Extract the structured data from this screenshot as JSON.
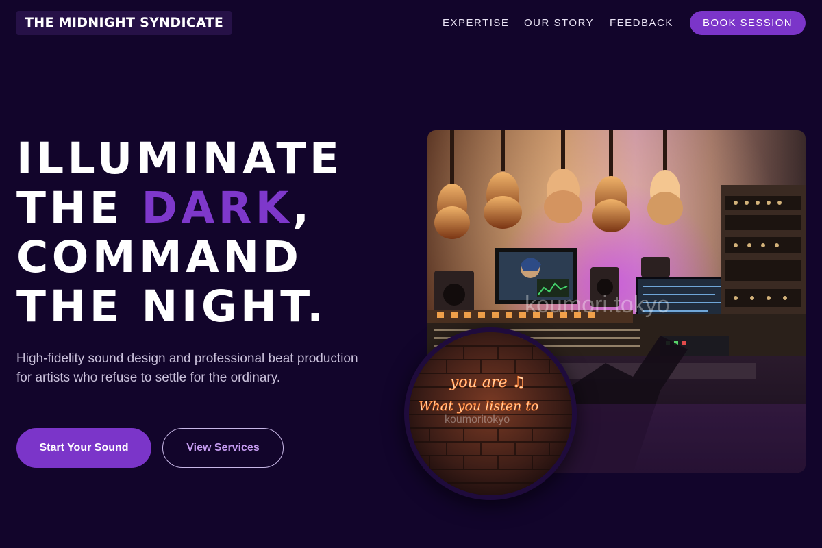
{
  "brand": {
    "name": "THE MIDNIGHT SYNDICATE"
  },
  "nav": {
    "links": [
      "EXPERTISE",
      "OUR STORY",
      "FEEDBACK"
    ],
    "cta": "BOOK SESSION"
  },
  "hero": {
    "headline_line1": "ILLUMINATE",
    "headline_line2_pre": "THE ",
    "headline_line2_accent": "DARK",
    "headline_line2_post": ",",
    "headline_line3": "COMMAND",
    "headline_line4": "THE NIGHT.",
    "description": "High-fidelity sound design and professional beat production for artists who refuse to settle for the ordinary.",
    "primary_button": "Start Your Sound",
    "secondary_button": "View Services"
  },
  "images": {
    "studio_watermark": "koumori.tokyo",
    "neon_line1": "you are ♫",
    "neon_line2": "What you listen to",
    "neon_watermark": "koumoritokyo"
  },
  "colors": {
    "background": "#12052b",
    "accent": "#7b35c9",
    "accent_text": "#7e38cb"
  }
}
